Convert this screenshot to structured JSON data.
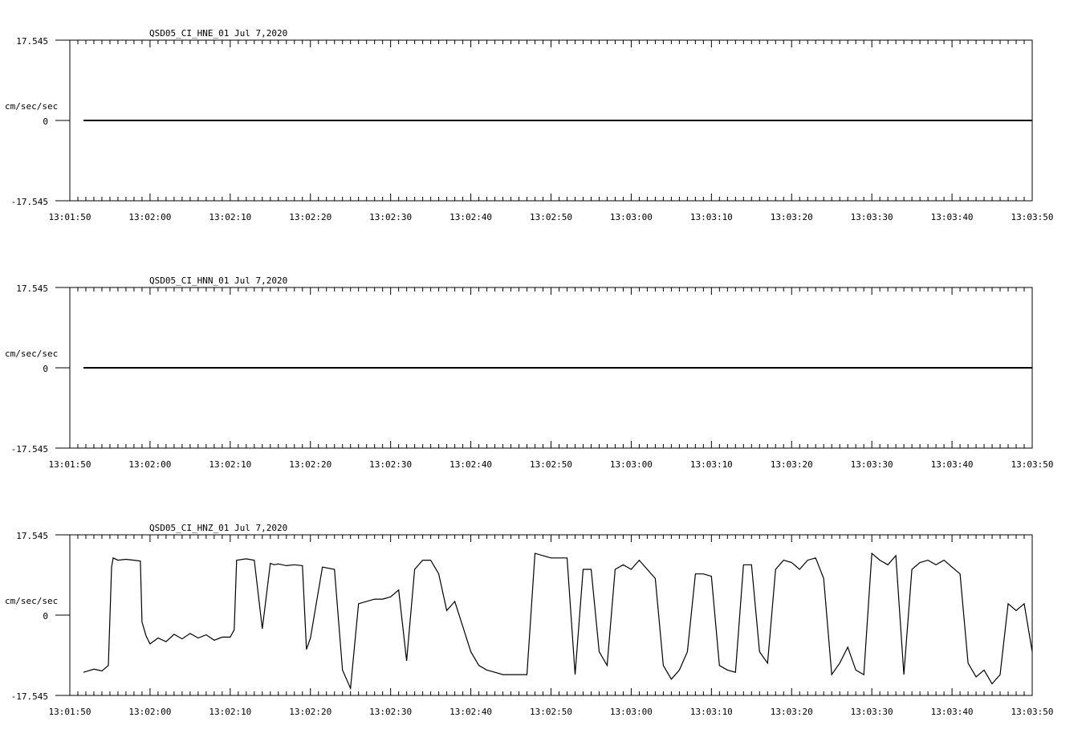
{
  "colors": {
    "background": "#ffffff",
    "trace": "#000000",
    "axis": "#000000"
  },
  "chart_data": [
    {
      "type": "line",
      "title": "QSD05_CI_HNE_01  Jul 7,2020",
      "ylabel": "cm/sec/sec",
      "ylim": [
        -17.545,
        17.545
      ],
      "y_tick_labels": [
        "17.545",
        "0",
        "-17.545"
      ],
      "x_tick_labels": [
        "13:01:50",
        "13:02:00",
        "13:02:10",
        "13:02:20",
        "13:02:30",
        "13:02:40",
        "13:02:50",
        "13:03:00",
        "13:03:10",
        "13:03:20",
        "13:03:30",
        "13:03:40",
        "13:03:50"
      ],
      "xlim_seconds": [
        0,
        120
      ],
      "x": [
        1.7,
        120
      ],
      "y": [
        0,
        0
      ]
    },
    {
      "type": "line",
      "title": "QSD05_CI_HNN_01  Jul 7,2020",
      "ylabel": "cm/sec/sec",
      "ylim": [
        -17.545,
        17.545
      ],
      "y_tick_labels": [
        "17.545",
        "0",
        "-17.545"
      ],
      "x_tick_labels": [
        "13:01:50",
        "13:02:00",
        "13:02:10",
        "13:02:20",
        "13:02:30",
        "13:02:40",
        "13:02:50",
        "13:03:00",
        "13:03:10",
        "13:03:20",
        "13:03:30",
        "13:03:40",
        "13:03:50"
      ],
      "xlim_seconds": [
        0,
        120
      ],
      "x": [
        1.7,
        120
      ],
      "y": [
        0,
        0
      ]
    },
    {
      "type": "line",
      "title": "QSD05_CI_HNZ_01  Jul 7,2020",
      "ylabel": "cm/sec/sec",
      "ylim": [
        -17.545,
        17.545
      ],
      "y_tick_labels": [
        "17.545",
        "0",
        "-17.545"
      ],
      "x_tick_labels": [
        "13:01:50",
        "13:02:00",
        "13:02:10",
        "13:02:20",
        "13:02:30",
        "13:02:40",
        "13:02:50",
        "13:03:00",
        "13:03:10",
        "13:03:20",
        "13:03:30",
        "13:03:40",
        "13:03:50"
      ],
      "xlim_seconds": [
        0,
        120
      ],
      "x": [
        1.7,
        3.0,
        4.0,
        4.8,
        5.2,
        5.4,
        6.0,
        7.0,
        8.0,
        8.8,
        9.0,
        9.5,
        10.0,
        11.0,
        12.0,
        13.0,
        14.0,
        15.0,
        16.0,
        17.0,
        18.0,
        19.0,
        20.0,
        20.5,
        20.8,
        22.0,
        23.0,
        24.0,
        25.0,
        25.5,
        26.0,
        27.0,
        28.0,
        29.0,
        29.5,
        30.0,
        31.5,
        33.0,
        34.0,
        35.0,
        36.0,
        38.0,
        39.0,
        40.0,
        41.0,
        42.0,
        43.0,
        44.0,
        45.0,
        46.0,
        47.0,
        48.0,
        50.0,
        51.0,
        52.0,
        53.0,
        54.0,
        55.0,
        56.0,
        57.0,
        58.0,
        59.0,
        60.0,
        61.0,
        62.0,
        63.0,
        64.0,
        65.0,
        66.0,
        67.0,
        68.0,
        69.0,
        70.0,
        71.0,
        72.0,
        73.0,
        74.0,
        75.0,
        76.0,
        77.0,
        78.0,
        79.0,
        80.0,
        81.0,
        82.0,
        83.0,
        84.0,
        85.0,
        86.0,
        87.0,
        88.0,
        89.0,
        90.0,
        91.0,
        92.0,
        93.0,
        94.0,
        95.0,
        96.0,
        97.0,
        98.0,
        99.0,
        100.0,
        101.0,
        102.0,
        103.0,
        104.0,
        105.0,
        106.0,
        107.0,
        108.0,
        109.0,
        110.0,
        111.0,
        112.0,
        113.0,
        114.0,
        115.0,
        116.0,
        117.0,
        118.0,
        119.0,
        120.0
      ],
      "y": [
        -12.5,
        -11.8,
        -12.2,
        -11.0,
        10.5,
        12.5,
        12.0,
        12.2,
        12.0,
        11.8,
        -1.5,
        -4.5,
        -6.3,
        -5.0,
        -5.8,
        -4.2,
        -5.2,
        -4.0,
        -5.0,
        -4.3,
        -5.5,
        -4.8,
        -4.8,
        -3.2,
        12.0,
        12.3,
        12.0,
        -3.0,
        11.3,
        11.0,
        11.2,
        10.8,
        11.0,
        10.8,
        -7.5,
        -5.0,
        10.5,
        10.0,
        -12.0,
        -16.0,
        2.5,
        3.5,
        3.5,
        4.0,
        5.5,
        -10.0,
        10.0,
        12.0,
        12.0,
        9.0,
        1.0,
        3.0,
        -8.0,
        -11.0,
        -12.0,
        -12.5,
        -13.0,
        -13.0,
        -13.0,
        -13.0,
        13.5,
        13.0,
        12.5,
        12.5,
        12.5,
        -13.0,
        10.0,
        10.0,
        -8.0,
        -11.0,
        10.0,
        11.0,
        10.0,
        12.0,
        10.0,
        8.0,
        -11.0,
        -14.0,
        -12.0,
        -8.0,
        9.0,
        9.0,
        8.5,
        -11.0,
        -12.0,
        -12.5,
        11.0,
        11.0,
        -8.0,
        -10.5,
        10.0,
        12.0,
        11.5,
        10.0,
        12.0,
        12.5,
        8.0,
        -13.0,
        -10.5,
        -7.0,
        -12.0,
        -13.0,
        13.5,
        12.0,
        11.0,
        13.0,
        -13.0,
        10.0,
        11.5,
        12.0,
        11.0,
        12.0,
        10.5,
        9.0,
        -10.5,
        -13.5,
        -12.0,
        -15.0,
        -13.0,
        2.5,
        1.0,
        2.5,
        -8.0,
        -15.0
      ]
    }
  ]
}
